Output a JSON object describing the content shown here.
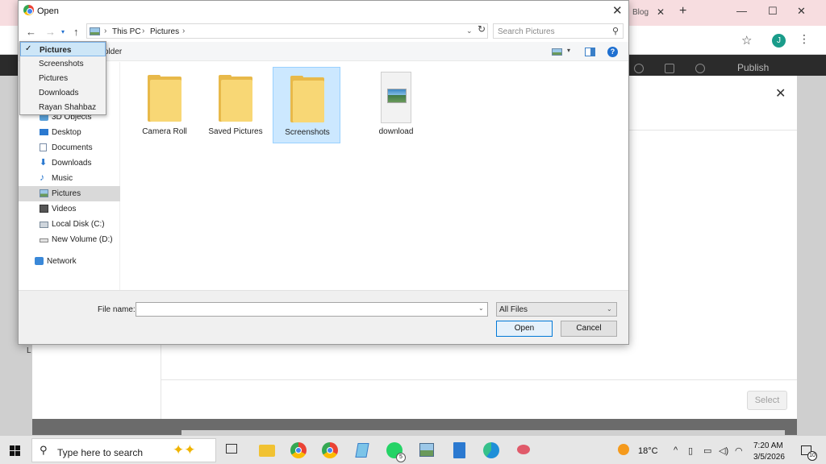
{
  "browser": {
    "tab_title_fragment": "Blog",
    "publish_label": "Publish",
    "profile_initial": "J"
  },
  "picker": {
    "select_label": "Select",
    "behind_letter": "L"
  },
  "dialog": {
    "title": "Open",
    "breadcrumb": [
      "This PC",
      "Pictures"
    ],
    "search_placeholder": "Search Pictures",
    "new_folder_fragment": "older",
    "dropdown": [
      {
        "label": "Pictures",
        "selected": true
      },
      {
        "label": "Screenshots",
        "selected": false
      },
      {
        "label": "Pictures",
        "selected": false
      },
      {
        "label": "Downloads",
        "selected": false
      },
      {
        "label": "Rayan Shahbaz",
        "selected": false
      }
    ],
    "nav_items": [
      {
        "label": "3D Objects",
        "icon": "cube-icon"
      },
      {
        "label": "Desktop",
        "icon": "desktop-icon"
      },
      {
        "label": "Documents",
        "icon": "document-icon"
      },
      {
        "label": "Downloads",
        "icon": "download-arrow-icon"
      },
      {
        "label": "Music",
        "icon": "music-note-icon"
      },
      {
        "label": "Pictures",
        "icon": "pictures-icon",
        "selected": true
      },
      {
        "label": "Videos",
        "icon": "video-icon"
      },
      {
        "label": "Local Disk (C:)",
        "icon": "local-disk-icon"
      },
      {
        "label": "New Volume (D:)",
        "icon": "drive-icon"
      },
      {
        "label": "Network",
        "icon": "network-icon"
      }
    ],
    "files": [
      {
        "name": "Camera Roll",
        "type": "folder",
        "selected": false
      },
      {
        "name": "Saved Pictures",
        "type": "folder",
        "selected": false
      },
      {
        "name": "Screenshots",
        "type": "folder",
        "selected": true
      },
      {
        "name": "download",
        "type": "image",
        "selected": false
      }
    ],
    "file_name_label": "File name:",
    "file_name_value": "",
    "file_type": "All Files",
    "open_label": "Open",
    "cancel_label": "Cancel"
  },
  "taskbar": {
    "search_placeholder": "Type here to search",
    "whatsapp_badge": "5",
    "weather": "18°C",
    "time": "7:20 AM",
    "date": "3/5/2026",
    "notifications": "10"
  },
  "colors": {
    "accent": "#0078d7",
    "selection": "#cce8ff",
    "folder": "#f8d775"
  }
}
